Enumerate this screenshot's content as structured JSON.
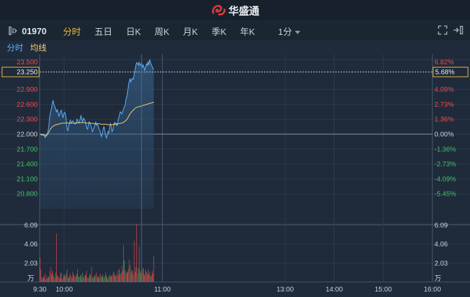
{
  "brand": {
    "name": "华盛通"
  },
  "header": {
    "code": "01970",
    "tabs": [
      "分时",
      "五日",
      "日K",
      "周K",
      "月K",
      "季K",
      "年K"
    ],
    "active_tab": "分时",
    "period": "1分"
  },
  "legend": {
    "time_label": "分时",
    "avg_label": "均线"
  },
  "icons": [
    "panel-toggle-icon",
    "chevron-down-icon",
    "expand-icon",
    "exit-icon"
  ],
  "colors": {
    "price_line": "#5db2ff",
    "avg_line": "#f3d26a",
    "up": "#f0484a",
    "down": "#3fbf62",
    "accent": "#f0b93a"
  },
  "chart_data": {
    "type": "line",
    "prev_close": 22.0,
    "ylim": [
      20.5,
      23.5
    ],
    "y_ticks": [
      "23.500",
      "23.250",
      "22.900",
      "22.600",
      "22.300",
      "22.000",
      "21.700",
      "21.400",
      "21.100",
      "20.800"
    ],
    "pct_ticks": [
      "6.82%",
      "5.68%",
      "4.09%",
      "2.73%",
      "1.36%",
      "0.00%",
      "-1.36%",
      "-2.73%",
      "-4.09%",
      "-5.45%"
    ],
    "crosshair": {
      "price": "23.250",
      "pct": "5.68%"
    },
    "x_ticks": [
      "9:30",
      "10:00",
      "11:00",
      "13:00",
      "14:00",
      "15:00",
      "16:00"
    ],
    "session_markers": [
      0,
      30,
      150,
      300,
      360,
      420,
      480
    ],
    "price": [
      22.0,
      22.0,
      21.98,
      21.99,
      22.0,
      21.98,
      21.93,
      21.97,
      22.0,
      22.01,
      22.1,
      22.2,
      22.38,
      22.45,
      22.52,
      22.63,
      22.68,
      22.59,
      22.55,
      22.51,
      22.44,
      22.5,
      22.43,
      22.36,
      22.4,
      22.46,
      22.48,
      22.39,
      22.33,
      22.42,
      22.44,
      22.4,
      22.28,
      22.1,
      22.07,
      22.16,
      22.24,
      22.28,
      22.22,
      22.25,
      22.27,
      22.25,
      22.22,
      22.2,
      22.22,
      22.3,
      22.28,
      22.22,
      22.25,
      22.3,
      22.38,
      22.3,
      22.25,
      22.32,
      22.3,
      22.27,
      22.21,
      22.12,
      22.1,
      22.18,
      22.25,
      22.22,
      22.18,
      22.12,
      22.05,
      22.08,
      22.14,
      22.18,
      22.24,
      22.18,
      22.2,
      22.16,
      22.1,
      22.08,
      22.0,
      21.95,
      22.02,
      22.1,
      22.15,
      22.08,
      21.98,
      21.92,
      21.97,
      22.05,
      22.02,
      22.12,
      22.22,
      22.15,
      22.05,
      22.08,
      22.18,
      22.24,
      22.2,
      22.22,
      22.16,
      22.25,
      22.32,
      22.38,
      22.45,
      22.43,
      22.41,
      22.45,
      22.51,
      22.55,
      22.58,
      22.71,
      22.75,
      22.86,
      22.98,
      23.06,
      23.11,
      23.05,
      23.11,
      23.12,
      23.1,
      23.2,
      23.29,
      23.38,
      23.44,
      23.42,
      23.39,
      23.45,
      23.38,
      23.4,
      23.44,
      23.35,
      23.39,
      23.34,
      23.28,
      23.36,
      23.41,
      23.38,
      23.46,
      23.39,
      23.5,
      23.44,
      23.4,
      23.36,
      23.32,
      23.3
    ],
    "avg": [
      22.0,
      21.99,
      21.99,
      21.99,
      21.98,
      21.98,
      21.97,
      21.96,
      21.97,
      22.0,
      22.02,
      22.05,
      22.08,
      22.11,
      22.13,
      22.15,
      22.16,
      22.17,
      22.18,
      22.19,
      22.19,
      22.2,
      22.2,
      22.2,
      22.21,
      22.21,
      22.22,
      22.22,
      22.22,
      22.22,
      22.22,
      22.22,
      22.23,
      22.23,
      22.22,
      22.22,
      22.22,
      22.22,
      22.22,
      22.22,
      22.22,
      22.22,
      22.22,
      22.22,
      22.22,
      22.23,
      22.23,
      22.23,
      22.23,
      22.23,
      22.23,
      22.23,
      22.23,
      22.23,
      22.23,
      22.23,
      22.23,
      22.22,
      22.22,
      22.22,
      22.22,
      22.22,
      22.22,
      22.22,
      22.22,
      22.21,
      22.21,
      22.21,
      22.21,
      22.21,
      22.21,
      22.21,
      22.21,
      22.21,
      22.2,
      22.2,
      22.2,
      22.2,
      22.2,
      22.2,
      22.2,
      22.2,
      22.19,
      22.19,
      22.19,
      22.19,
      22.19,
      22.19,
      22.19,
      22.19,
      22.2,
      22.2,
      22.2,
      22.2,
      22.2,
      22.21,
      22.21,
      22.21,
      22.22,
      22.22,
      22.22,
      22.23,
      22.24,
      22.25,
      22.26,
      22.28,
      22.29,
      22.32,
      22.35,
      22.38,
      22.41,
      22.43,
      22.45,
      22.47,
      22.48,
      22.5,
      22.52,
      22.53,
      22.54,
      22.54,
      22.55,
      22.55,
      22.56,
      22.56,
      22.57,
      22.57,
      22.58,
      22.58,
      22.59,
      22.59,
      22.6,
      22.6,
      22.61,
      22.61,
      22.62,
      22.62,
      22.63,
      22.63,
      22.64,
      22.64
    ],
    "volume_ticks": [
      "6.09",
      "4.06",
      "2.03"
    ],
    "volume_unit": "万",
    "volume": [
      2.6,
      1.3,
      0.5,
      0.3,
      0.6,
      0.4,
      0.9,
      0.3,
      0.7,
      0.4,
      0.5,
      0.6,
      1.1,
      1.6,
      0.8,
      1.2,
      0.9,
      0.6,
      0.4,
      1.0,
      5.2,
      0.7,
      0.5,
      0.6,
      0.4,
      0.9,
      1.0,
      0.3,
      0.5,
      0.8,
      0.7,
      0.6,
      0.9,
      1.3,
      0.5,
      0.4,
      0.7,
      0.9,
      0.6,
      0.4,
      1.1,
      0.8,
      0.6,
      0.5,
      0.7,
      0.9,
      1.4,
      0.6,
      0.5,
      0.7,
      0.8,
      0.4,
      1.0,
      0.6,
      0.5,
      0.8,
      0.7,
      1.2,
      0.5,
      0.4,
      0.6,
      0.9,
      0.7,
      1.6,
      0.5,
      0.4,
      0.7,
      0.6,
      0.8,
      1.0,
      0.5,
      0.6,
      0.4,
      0.7,
      0.9,
      0.5,
      0.6,
      0.8,
      0.4,
      0.6,
      1.0,
      0.7,
      0.5,
      0.3,
      0.6,
      0.8,
      0.5,
      0.7,
      0.6,
      0.9,
      1.1,
      0.8,
      0.7,
      0.6,
      0.9,
      1.2,
      0.7,
      1.4,
      0.8,
      1.0,
      1.7,
      1.2,
      3.9,
      2.3,
      1.3,
      1.0,
      0.9,
      1.1,
      1.4,
      2.4,
      1.8,
      1.0,
      1.3,
      1.2,
      0.8,
      4.4,
      1.1,
      1.6,
      6.2,
      0.9,
      1.5,
      3.8,
      1.2,
      1.0,
      0.8,
      1.3,
      1.5,
      0.9,
      0.7,
      1.3,
      1.1,
      0.9,
      1.4,
      0.8,
      1.1,
      0.7,
      0.6,
      1.2,
      0.9,
      2.8
    ],
    "volume_dir": "rrgrgrrgrrrgrrgrrgrrrgrrgrgrrgrrrgrgrrgrrgrrgrrgrgrrgrrgrrrgrgrrgrrgrrrgrgrrgrrgrgrrgrrgrrgrrgrrrgrgrrrgrrrgrrgrrrgrrrrrgrrgrrgrrgrgrrrgrrr"
  }
}
